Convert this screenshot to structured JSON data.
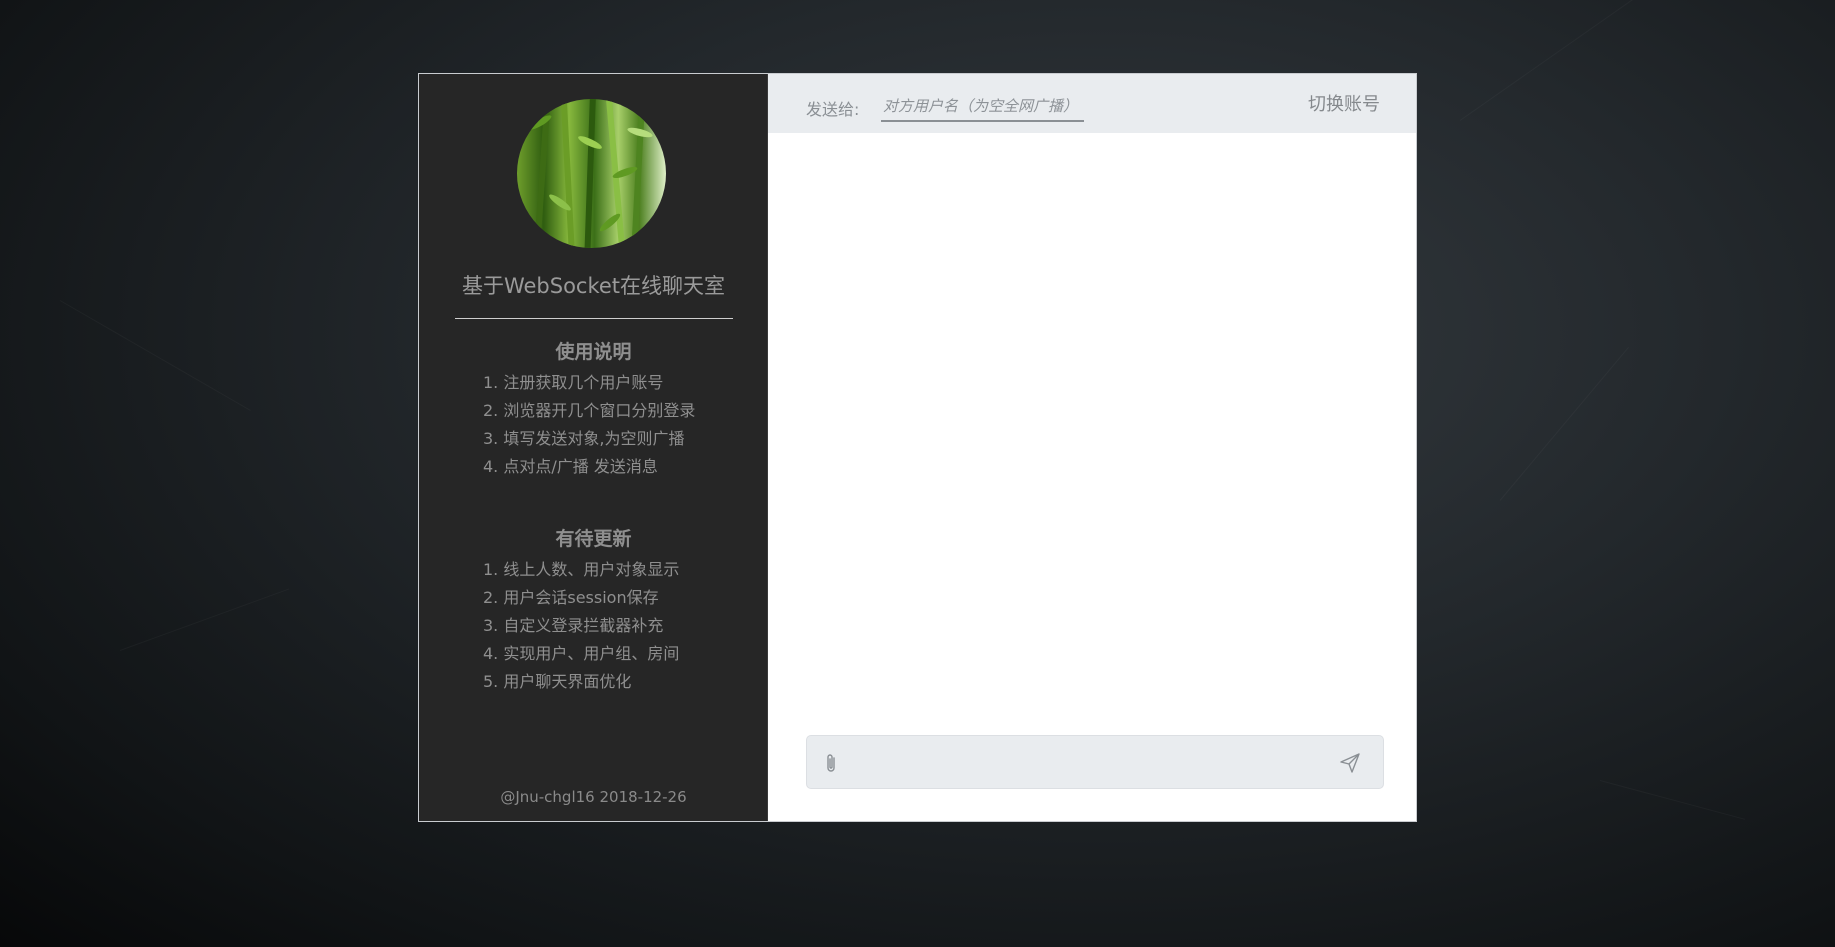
{
  "sidebar": {
    "app_title": "基于WebSocket在线聊天室",
    "usage_heading": "使用说明",
    "usage_items": [
      "1. 注册获取几个用户账号",
      "2. 浏览器开几个窗口分别登录",
      "3. 填写发送对象,为空则广播",
      "4. 点对点/广播 发送消息"
    ],
    "todo_heading": "有待更新",
    "todo_items": [
      "1. 线上人数、用户对象显示",
      "2. 用户会话session保存",
      "3. 自定义登录拦截器补充",
      "4. 实现用户、用户组、房间",
      "5. 用户聊天界面优化"
    ],
    "footer": "@Jnu-chgl16 2018-12-26"
  },
  "topbar": {
    "send_to_label": "发送给:",
    "recipient_placeholder": "对方用户名（为空全网广播）",
    "recipient_value": "",
    "switch_account": "切换账号"
  },
  "composer": {
    "message_value": "",
    "attach_icon": "paperclip-icon",
    "send_icon": "paper-plane-icon"
  },
  "colors": {
    "sidebar_bg": "#262626",
    "topbar_bg": "#e9ecef",
    "page_bg": "#1c2023"
  }
}
